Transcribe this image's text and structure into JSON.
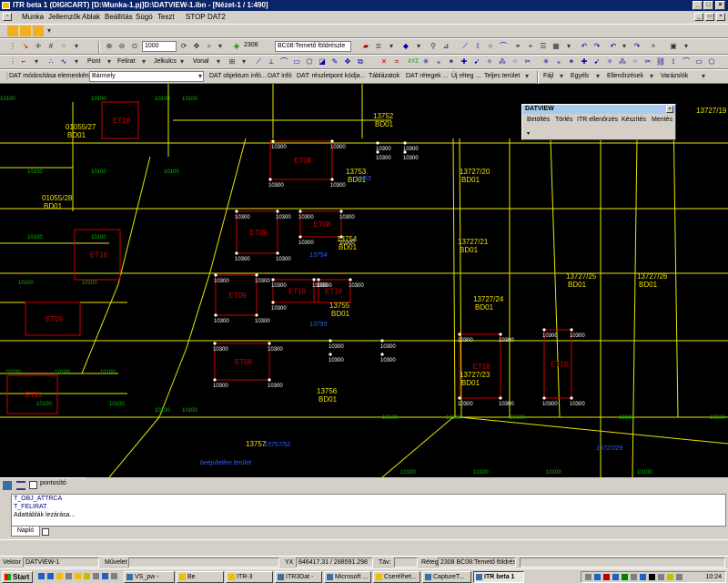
{
  "window": {
    "title": "ITR beta 1  (DIGICART)  [D:\\Munka-1.pj]D:\\DATVIEW-1.ibn - [Nézet-1 / 1:490]"
  },
  "menu": [
    "Munka",
    "Jellemzők",
    "Ablak",
    "Beállítás",
    "Súgó",
    "Teszt",
    "STOP",
    "DAT2"
  ],
  "toolbar2": {
    "zoom_value": "1000",
    "layer_code": "2308",
    "layer_name": "BC08:Temető földrészle"
  },
  "toolbar3": {
    "items": [
      "Pont",
      "Felirat",
      "Jelkulcs",
      "Vonal"
    ]
  },
  "toolbar3_right": [
    "Fájl",
    "Egyéb",
    "Ellenőrzések",
    "Varázslók"
  ],
  "toolbar4": {
    "label": "DAT módosítása elemenként",
    "select_value": "Bármely",
    "buttons": [
      "DAT objektum infó...",
      "DAT infó",
      "DAT: részletpont kódja...",
      "Táblázatok",
      "DAT rétegek ...",
      "Új réteg ...",
      "Teljes terület"
    ]
  },
  "datview": {
    "title": "DATVIEW",
    "items": [
      "Betöltés",
      "Törlés",
      "ITR ellenőrzés",
      "Készítés",
      "Mentés"
    ]
  },
  "map": {
    "parcels": [
      {
        "id": "01055/27",
        "code": "BD01"
      },
      {
        "id": "01055/28",
        "code": "BD01"
      },
      {
        "id": "13752",
        "code": "BD01"
      },
      {
        "id": "13753",
        "code": "BD01"
      },
      {
        "id": "13754",
        "code": "BD01"
      },
      {
        "id": "13755",
        "code": "BD01"
      },
      {
        "id": "13756",
        "code": "BD01"
      },
      {
        "id": "13757",
        "code": ""
      },
      {
        "id": "13727/20",
        "code": "BD01"
      },
      {
        "id": "13727/21",
        "code": "BD01"
      },
      {
        "id": "13727/24",
        "code": "BD01"
      },
      {
        "id": "13727/23",
        "code": "BD01"
      },
      {
        "id": "13727/25",
        "code": "BD01"
      },
      {
        "id": "13727/26",
        "code": "BD01"
      },
      {
        "id": "13727/19",
        "code": ""
      }
    ],
    "buildings": [
      "ET18",
      "ET08",
      "ET09",
      "ET08",
      "ET09",
      "ET18",
      "ET18",
      "ET09",
      "ET18",
      "ET09",
      "ET18",
      "ET18",
      "ET18"
    ],
    "blue_texts": [
      "12/53",
      "13754",
      "13755",
      "13757/52",
      "beépítetlen terület",
      "13727/29"
    ],
    "node_code": "10300",
    "green_code": "10100"
  },
  "side_tabs": {
    "checkbox_label": "pontosító"
  },
  "log": {
    "lines": [
      "T_OBJ_ATTRCA",
      "T_FELIRAT",
      "Adattáblák lezárása..."
    ],
    "tab": "Napló"
  },
  "status": {
    "vektor_label": "Vektor",
    "vektor_value": "DATVIEW-1",
    "muvelet_label": "Művelet",
    "yx_label": "YX",
    "yx_value": "846417.31 / 288591.298",
    "tav_label": "Táv:",
    "reteg_label": "Réteg",
    "reteg_value": "2308  BC08:Temető földrész"
  },
  "taskbar": {
    "start": "Start",
    "tasks": [
      "VS_pw -",
      "Be",
      "ITR-3",
      "ITR3Dat -",
      "Microsoft ...",
      "Cserélhet...",
      "CaptureT...",
      "ITR beta 1"
    ],
    "clock": "10:24"
  },
  "colors": {
    "yellow": "#e6e600",
    "red": "#d00000",
    "green": "#00c000",
    "blue": "#3060ff",
    "label": "#f0e000"
  }
}
